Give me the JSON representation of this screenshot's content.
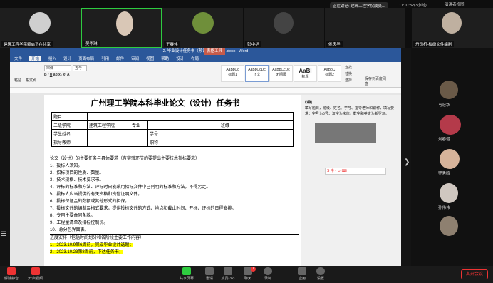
{
  "top_bar": {
    "share_banner": "正在讲话: 建筑工程学院成员...",
    "clock": "11:10:32(3小时)",
    "speaker_view": "演讲者视图"
  },
  "participants_top": [
    {
      "name": "建筑工程学院戴启正在共享",
      "color": "#cfcfcf"
    },
    {
      "name": "吴华琳",
      "color": "#d9c7b6"
    },
    {
      "name": "王春伟",
      "color": "#6f8f3a"
    },
    {
      "name": "彭中华",
      "color": "#2e2e2e"
    },
    {
      "name": "侯庆华",
      "color": "#1e1e1e"
    },
    {
      "name": "丹司机-校级文件编制",
      "color": "#bfb0a0"
    }
  ],
  "participants_right": [
    {
      "name": "马冠华",
      "color": "#6a5a48"
    },
    {
      "name": "刘春惜",
      "color": "#b43a4a"
    },
    {
      "name": "罗秀鸣",
      "color": "#d6b39a"
    },
    {
      "name": "孙伟伟",
      "color": "#cfc7c0"
    },
    {
      "name": "",
      "color": "#8e8070"
    }
  ],
  "word": {
    "titlebar": "2. 毕业设计任务书（预设文件编制）.docx - Word",
    "table_tools": "表格工具",
    "menus": [
      "文件",
      "开始",
      "插入",
      "设计",
      "页面布局",
      "引用",
      "邮件",
      "审阅",
      "视图",
      "帮助",
      "设计",
      "布局"
    ],
    "font_name": "宋体",
    "font_size": "五号",
    "paste": "粘贴",
    "format_painter": "格式刷",
    "styles": [
      "AaBbCc",
      "AaBbCcDc",
      "AaBbCcDc",
      "AaBl",
      "AaBbC"
    ],
    "style_names": [
      "标题1",
      "正文",
      "无间隔",
      "标题",
      "标题2"
    ],
    "find": "查找",
    "replace": "替换",
    "select": "选择",
    "save_to_cloud": "保存到百度网盘",
    "doc_title": "广州理工学院本科毕业论文（设计）任务书",
    "form": {
      "topic": "题目",
      "college": "二级学院",
      "college_value": "建筑工程学院",
      "major": "专业",
      "class": "班级",
      "student": "学生姓名",
      "student_id": "学号",
      "advisor": "指导教师",
      "title": "职称"
    },
    "requirements": [
      "论文（设计）的主要任务与具体要求（有实验环节的要提出主要技术指标要求）",
      "1、投标人须知。",
      "2、招标项目的性质、数量。",
      "3、技术规格、技术要求书。",
      "4、评标的标准和方法、评标时只能采用招标文件中已列明的标准和方法，不得另定。",
      "5、投标人应当提供的有关资格和资信证明文件。",
      "6、投标保证金的数额或其他形式的担保。",
      "7、投标文件的编制及格式要求，提供投标文件的方式、地点和截止时间、开标、评标的日程安排。",
      "8、专用主要合同条款。",
      "9、工程量清单及招标控制价。",
      "10、总分包界面表。"
    ],
    "schedule_title": "进度安排（包括时间划分和各阶段主要工作内容）",
    "schedule": [
      "1、2023.10.9第6周前，完成毕业设计选题；",
      "2、2023.10.23第8周前，下达任务书；"
    ],
    "comment": {
      "author": "匹碗",
      "text": "填写题目，班级、姓名、学号、指导老师和职称，填写要求：字号为5号；汉字为宋体，数字和英文为新罗马。"
    }
  },
  "bottom": {
    "mute": "解除静音",
    "video": "开启视频",
    "share": "共享屏幕",
    "invite": "邀请",
    "members": "成员(32)",
    "chat": "聊天",
    "record": "录制",
    "apps": "应用",
    "settings": "设置",
    "leave": "离开会议",
    "chat_badge": "1"
  }
}
